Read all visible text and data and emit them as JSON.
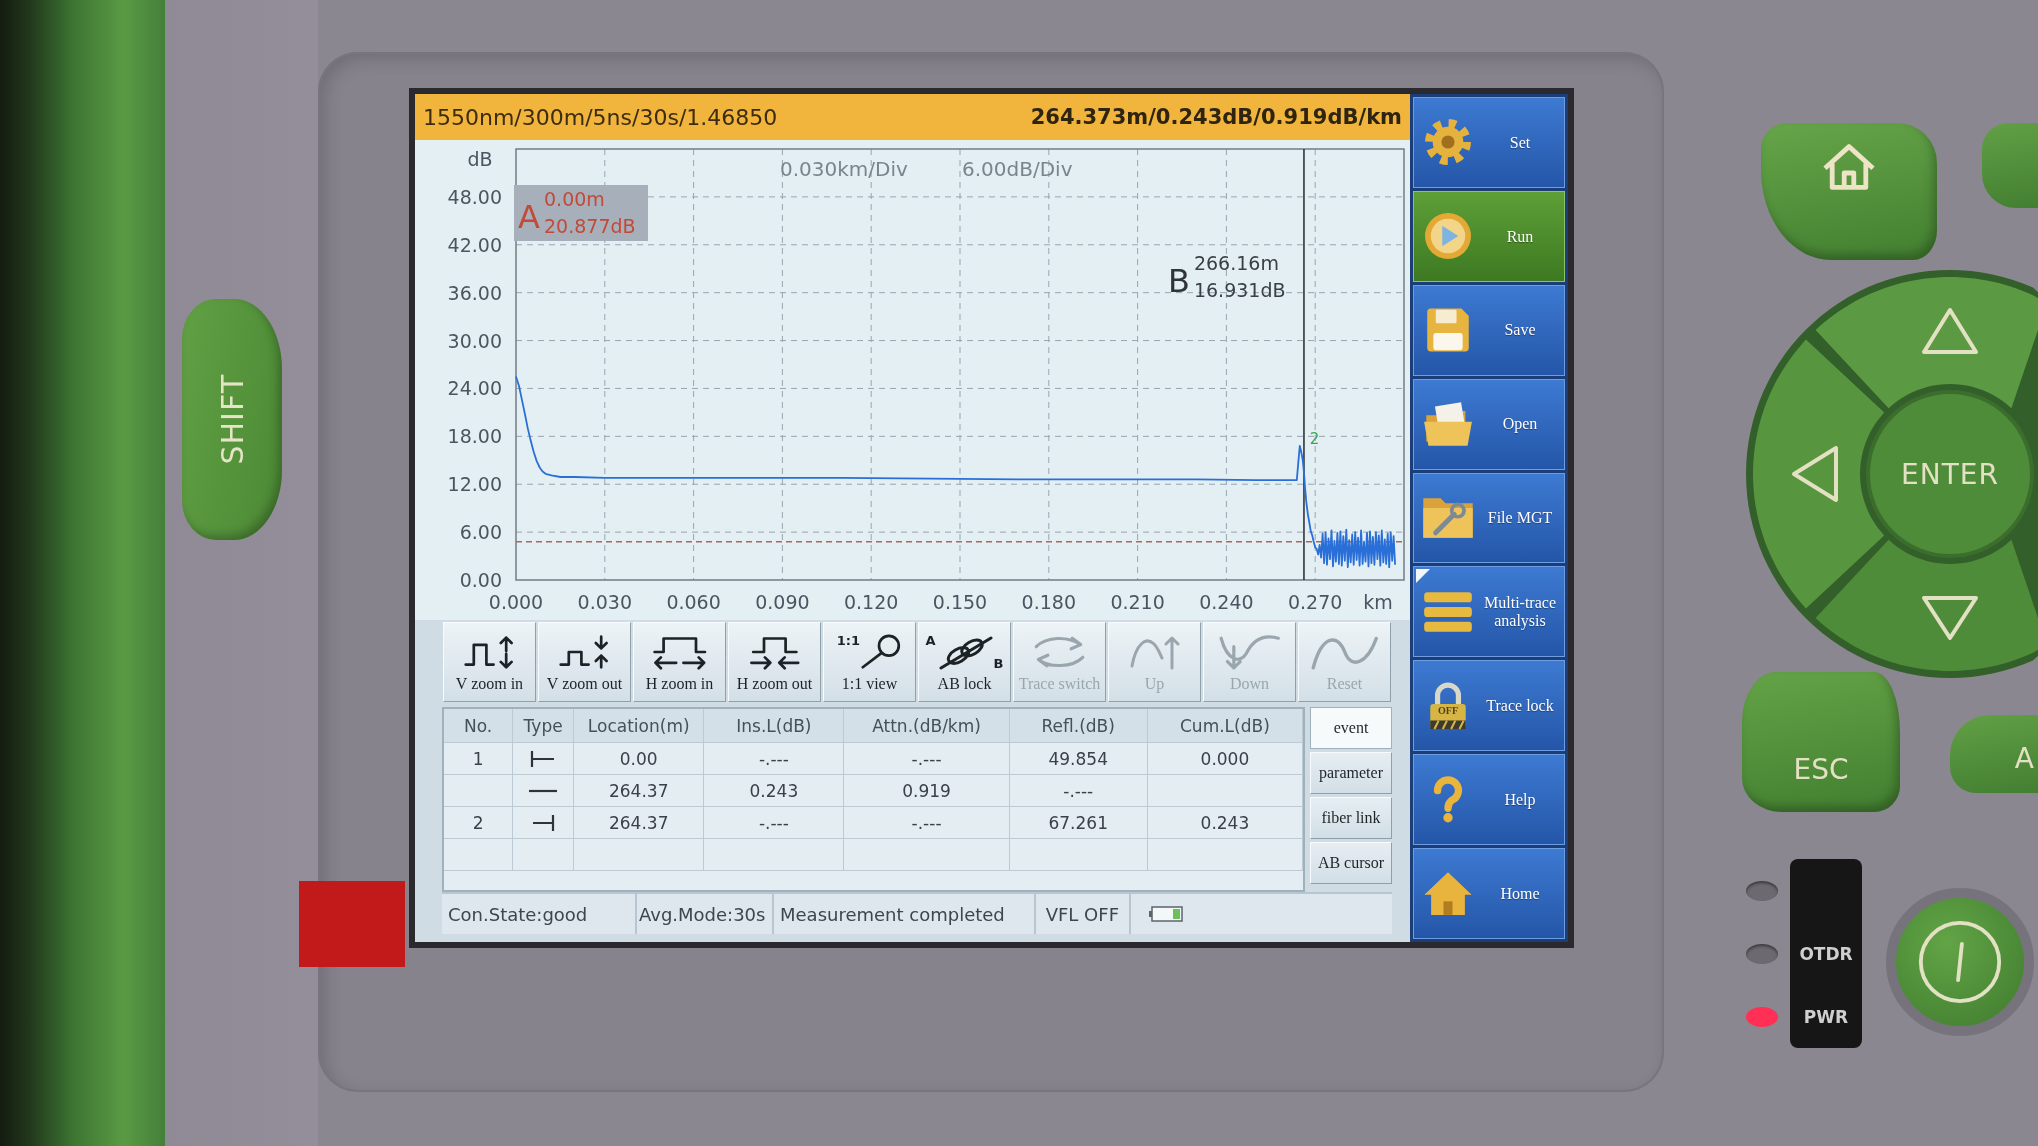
{
  "device": {
    "shift_key": "SHIFT",
    "enter_key": "ENTER",
    "esc_key": "ESC",
    "side_key": "A",
    "indicators": [
      {
        "on": false
      },
      {
        "label": "OTDR",
        "on": false
      },
      {
        "label": "PWR",
        "on": true
      }
    ]
  },
  "info_bar": {
    "settings": "1550nm/300m/5ns/30s/1.46850",
    "result": "264.373m/0.243dB/0.919dB/km"
  },
  "trace_view": {
    "scales": [
      "0.030km/Div",
      "6.00dB/Div"
    ],
    "cursors": [
      {
        "letter": "A",
        "distance": "0.00m",
        "loss": "20.877dB",
        "active": true
      },
      {
        "letter": "B",
        "distance": "266.16m",
        "loss": "16.931dB",
        "active": false
      }
    ],
    "chart_data": {
      "type": "line",
      "xlabel": "km",
      "ylabel": "dB",
      "grid": true,
      "xlim": [
        0,
        0.3
      ],
      "ylim": [
        0,
        54
      ],
      "xticks": [
        {
          "value": 0,
          "label": "0.000"
        },
        {
          "value": 0.03,
          "label": "0.030"
        },
        {
          "value": 0.06,
          "label": "0.060"
        },
        {
          "value": 0.09,
          "label": "0.090"
        },
        {
          "value": 0.12,
          "label": "0.120"
        },
        {
          "value": 0.15,
          "label": "0.150"
        },
        {
          "value": 0.18,
          "label": "0.180"
        },
        {
          "value": 0.21,
          "label": "0.210"
        },
        {
          "value": 0.24,
          "label": "0.240"
        },
        {
          "value": 0.27,
          "label": "0.270"
        }
      ],
      "yticks": [
        {
          "value": 0,
          "label": "0.00"
        },
        {
          "value": 6,
          "label": "6.00"
        },
        {
          "value": 12,
          "label": "12.00"
        },
        {
          "value": 18,
          "label": "18.00"
        },
        {
          "value": 24,
          "label": "24.00"
        },
        {
          "value": 30,
          "label": "30.00"
        },
        {
          "value": 36,
          "label": "36.00"
        },
        {
          "value": 42,
          "label": "42.00"
        },
        {
          "value": 48,
          "label": "48.00"
        }
      ],
      "x": [
        0,
        0.001,
        0.002,
        0.003,
        0.004,
        0.005,
        0.006,
        0.007,
        0.008,
        0.009,
        0.01,
        0.012,
        0.015,
        0.02,
        0.03,
        0.05,
        0.08,
        0.11,
        0.14,
        0.17,
        0.2,
        0.23,
        0.25,
        0.26,
        0.2638,
        0.2642,
        0.2648,
        0.2652,
        0.2658,
        0.2662,
        0.2666,
        0.267,
        0.2675,
        0.268,
        0.2685,
        0.269,
        0.2695,
        0.27,
        0.2705,
        0.271,
        0.2715,
        0.272,
        0.2725,
        0.273,
        0.2735,
        0.274,
        0.2745,
        0.275,
        0.2755,
        0.276,
        0.2765,
        0.277,
        0.2775,
        0.278,
        0.2785,
        0.279,
        0.2795,
        0.28,
        0.2805,
        0.281,
        0.2815,
        0.282,
        0.2825,
        0.283,
        0.2835,
        0.284,
        0.2845,
        0.285,
        0.2855,
        0.286,
        0.2865,
        0.287,
        0.2875,
        0.288,
        0.2885,
        0.289,
        0.2895,
        0.29,
        0.2905,
        0.291,
        0.2915,
        0.292,
        0.2925,
        0.293,
        0.2935,
        0.294,
        0.2945,
        0.295,
        0.2955,
        0.296,
        0.2965,
        0.297
      ],
      "series": [
        {
          "color": "#2a6fd8",
          "values": [
            25.5,
            24.3,
            22.6,
            20.8,
            19.0,
            17.4,
            16.0,
            14.9,
            14.1,
            13.6,
            13.3,
            13.1,
            12.9,
            12.9,
            12.8,
            12.8,
            12.8,
            12.8,
            12.7,
            12.6,
            12.6,
            12.6,
            12.5,
            12.5,
            12.5,
            14.3,
            16.8,
            16.2,
            15.0,
            13.4,
            11.5,
            9.8,
            8.3,
            7.2,
            6.1,
            5.6,
            4.8,
            4.1,
            3.9,
            3.2,
            4.4,
            2.8,
            5.8,
            2.1,
            6.0,
            1.9,
            5.2,
            2.6,
            6.2,
            1.7,
            4.9,
            2.3,
            5.9,
            2.0,
            6.1,
            1.8,
            5.5,
            2.4,
            6.3,
            1.6,
            5.0,
            2.2,
            5.7,
            1.9,
            6.0,
            2.5,
            5.3,
            1.8,
            6.2,
            2.0,
            4.8,
            2.3,
            5.9,
            1.7,
            6.1,
            2.1,
            5.4,
            1.9,
            6.0,
            2.6,
            5.6,
            1.8,
            6.2,
            2.2,
            5.1,
            2.0,
            5.8,
            1.6,
            6.0,
            2.4,
            5.5,
            1.9
          ]
        }
      ],
      "ref_lines": [
        {
          "axis": "x",
          "value": 0.2662
        },
        {
          "axis": "y",
          "value": 4.8
        }
      ],
      "annotations": [
        {
          "x": 0.2648,
          "y": 16.8,
          "text": "2"
        }
      ]
    }
  },
  "toolbar": [
    {
      "label": "V zoom in",
      "kind": "vzoomin",
      "disabled": false
    },
    {
      "label": "V zoom out",
      "kind": "vzoomout",
      "disabled": false
    },
    {
      "label": "H zoom in",
      "kind": "hzoomin",
      "disabled": false
    },
    {
      "label": "H zoom out",
      "kind": "hzoomout",
      "disabled": false
    },
    {
      "label": "1:1 view",
      "kind": "view",
      "icon_text": [
        "1:1"
      ],
      "disabled": false
    },
    {
      "label": "AB lock",
      "kind": "lock",
      "icon_text": [
        "A",
        "B"
      ],
      "disabled": false
    },
    {
      "label": "Trace switch",
      "kind": "switch",
      "disabled": true
    },
    {
      "label": "Up",
      "kind": "up",
      "disabled": true
    },
    {
      "label": "Down",
      "kind": "down",
      "disabled": true
    },
    {
      "label": "Reset",
      "kind": "reset",
      "disabled": true
    }
  ],
  "event_table": {
    "columns": [
      "No.",
      "Type",
      "Location(m)",
      "Ins.L(dB)",
      "Attn.(dB/km)",
      "Refl.(dB)",
      "Cum.L(dB)"
    ],
    "rows": [
      {
        "no": "1",
        "kind": "start",
        "location": "0.00",
        "ins_loss": "-.---",
        "attenuation": "-.---",
        "reflectance": "49.854",
        "cumulative_loss": "0.000"
      },
      {
        "kind": "span",
        "location": "264.37",
        "ins_loss": "0.243",
        "attenuation": "0.919",
        "reflectance": "-.---"
      },
      {
        "no": "2",
        "kind": "end",
        "location": "264.37",
        "ins_loss": "-.---",
        "attenuation": "-.---",
        "reflectance": "67.261",
        "cumulative_loss": "0.243"
      }
    ]
  },
  "view_tabs": [
    {
      "label": "event",
      "selected": true
    },
    {
      "label": "parameter",
      "selected": false
    },
    {
      "label": "fiber link",
      "selected": false
    },
    {
      "label": "AB cursor",
      "selected": false
    }
  ],
  "status_bar": {
    "connection": "Con.State:good",
    "averaging": "Avg.Mode:30s",
    "message": "Measurement completed",
    "vfl": "VFL OFF"
  },
  "side_menu": [
    {
      "label": "Set",
      "kind": "settings",
      "selected": false,
      "submenu": false
    },
    {
      "label": "Run",
      "kind": "run",
      "selected": true,
      "submenu": false
    },
    {
      "label": "Save",
      "kind": "save",
      "selected": false,
      "submenu": false
    },
    {
      "label": "Open",
      "kind": "open",
      "selected": false,
      "submenu": false
    },
    {
      "label": "File MGT",
      "kind": "files",
      "selected": false,
      "submenu": false
    },
    {
      "label": "Multi-trace analysis",
      "kind": "multitrace",
      "selected": false,
      "submenu": true
    },
    {
      "label": "Trace lock",
      "kind": "lock",
      "badge": "OFF",
      "selected": false,
      "submenu": false
    },
    {
      "label": "Help",
      "kind": "help",
      "selected": false,
      "submenu": false
    },
    {
      "label": "Home",
      "kind": "home",
      "selected": false,
      "submenu": false
    }
  ]
}
